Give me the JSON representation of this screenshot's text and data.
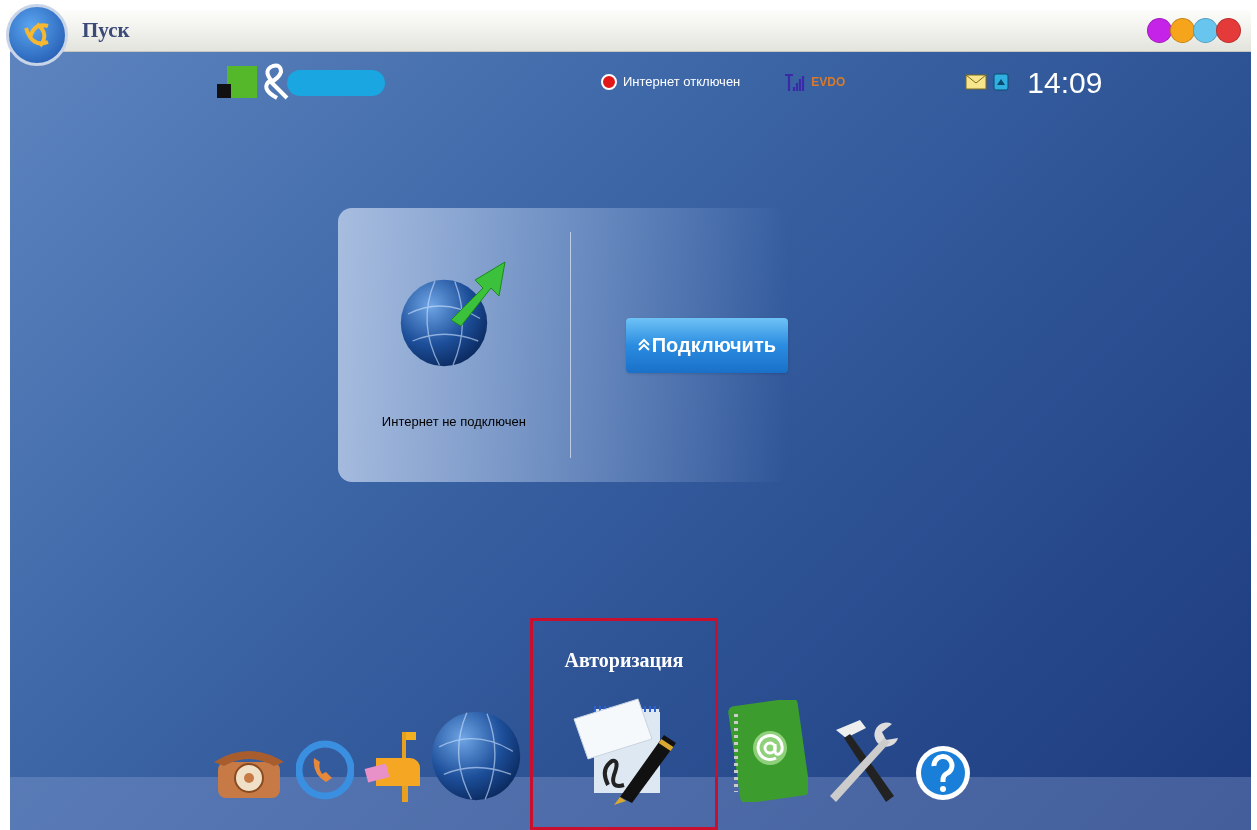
{
  "window": {
    "title": "Пуск"
  },
  "status_bar": {
    "internet": {
      "text": "Интернет отключен",
      "connected": false
    },
    "network": "EVDO",
    "clock": "14:09"
  },
  "connection_card": {
    "status_text": "Интернет не подключен",
    "connected": false,
    "button": "Подключить"
  },
  "dock": [
    {
      "kind": "phone",
      "selected": false
    },
    {
      "kind": "sync",
      "selected": false
    },
    {
      "kind": "mailbox",
      "selected": false
    },
    {
      "kind": "globe",
      "selected": false
    },
    {
      "kind": "authorization",
      "selected": true,
      "label": "Авторизация"
    },
    {
      "kind": "addressbook",
      "selected": false
    },
    {
      "kind": "tools",
      "selected": false
    },
    {
      "kind": "help",
      "selected": false
    }
  ]
}
